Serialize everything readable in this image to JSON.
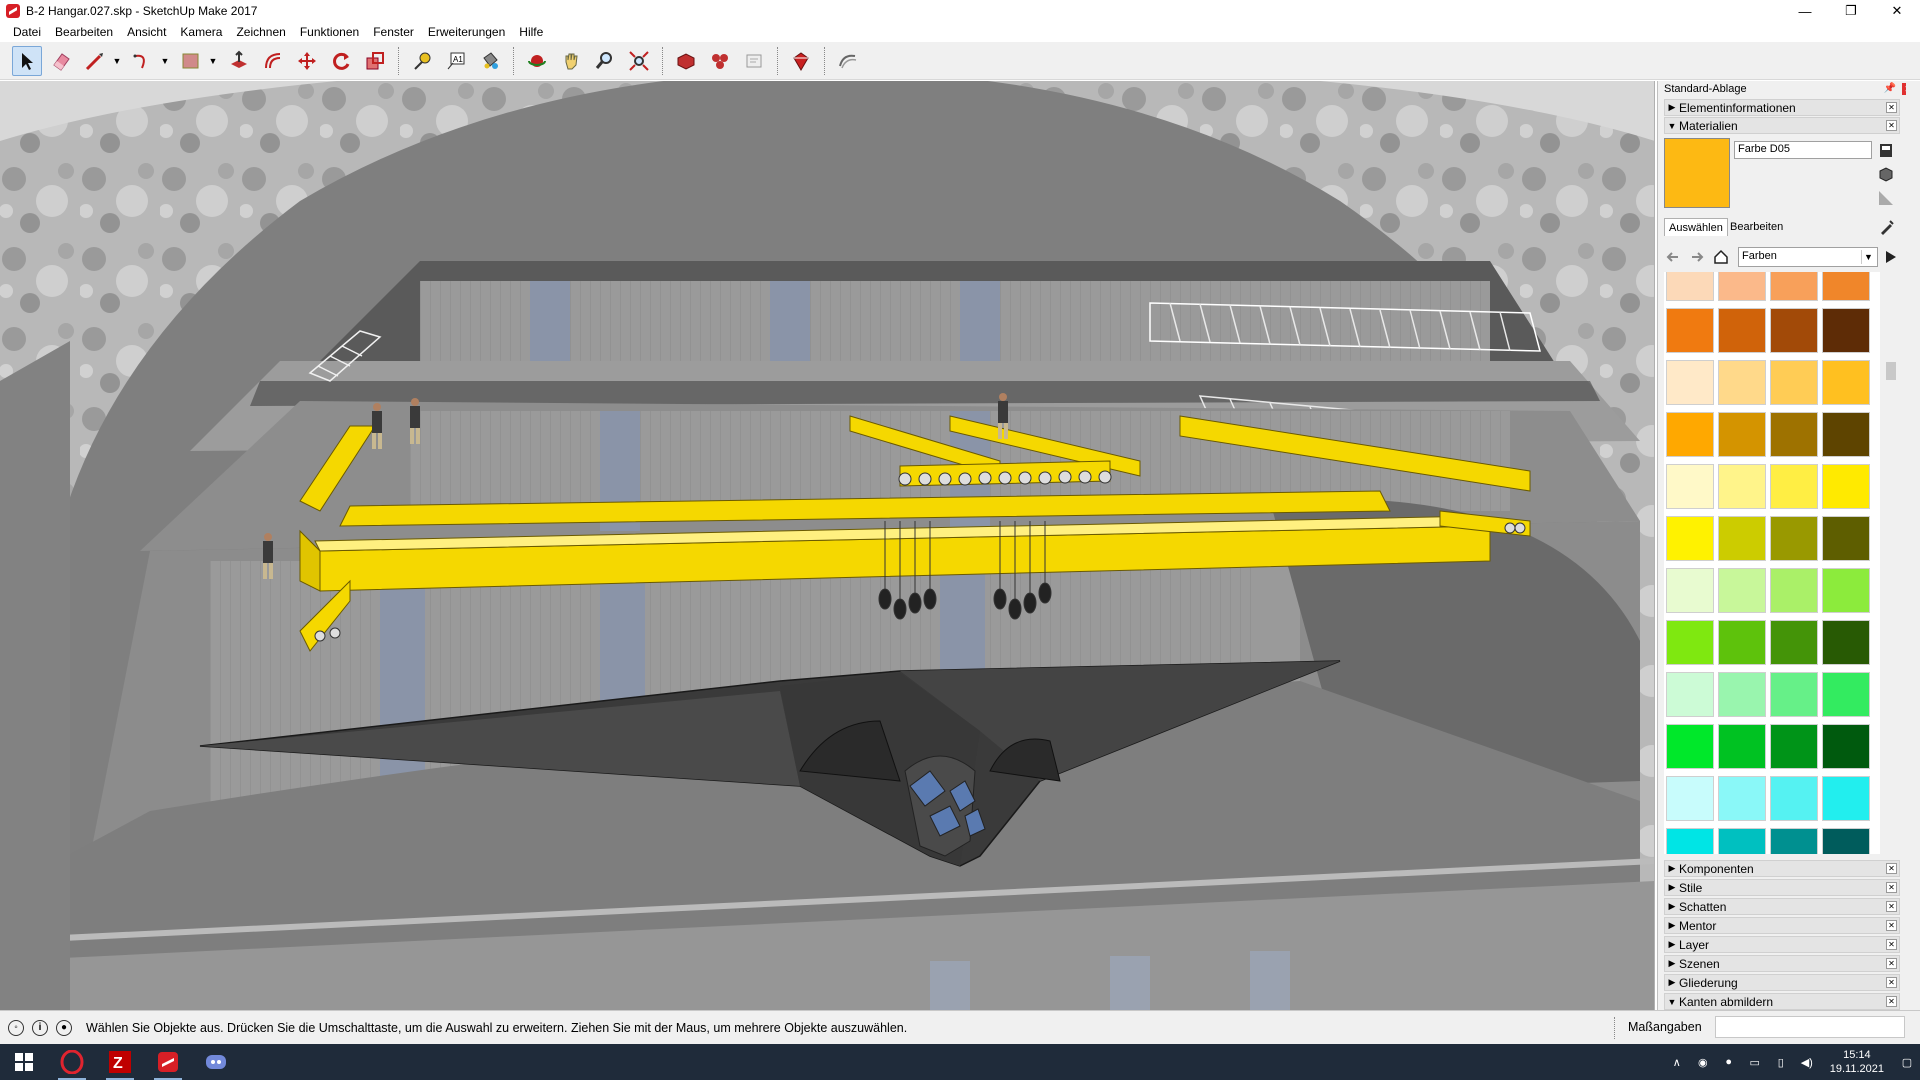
{
  "window": {
    "title": "B-2 Hangar.027.skp - SketchUp Make 2017",
    "minimize": "—",
    "maximize": "❐",
    "close": "✕"
  },
  "menu": [
    "Datei",
    "Bearbeiten",
    "Ansicht",
    "Kamera",
    "Zeichnen",
    "Funktionen",
    "Fenster",
    "Erweiterungen",
    "Hilfe"
  ],
  "toolbar": {
    "tools": [
      "select-tool",
      "eraser-tool",
      "line-tool",
      "arc-tool",
      "shape-tool",
      "push-pull-tool",
      "offset-tool",
      "move-tool",
      "rotate-tool",
      "scale-tool",
      "tape-measure-tool",
      "text-tool",
      "paint-bucket-tool",
      "orbit-tool",
      "pan-tool",
      "zoom-tool",
      "zoom-extents-tool",
      "3d-warehouse-tool",
      "extension-warehouse-tool",
      "layout-tool",
      "extension-manager-tool",
      "sandbox-tool"
    ]
  },
  "tray": {
    "title": "Standard-Ablage",
    "panels_top": [
      {
        "label": "Elementinformationen",
        "expanded": false
      },
      {
        "label": "Materialien",
        "expanded": true
      }
    ],
    "material": {
      "name": "Farbe D05",
      "color": "#FDB913",
      "tabs": [
        "Auswählen",
        "Bearbeiten"
      ],
      "active_tab": "Auswählen",
      "library": "Farben"
    },
    "swatch_rows": [
      [
        "#FCD9B8",
        "#FBB98A",
        "#F8A05A",
        "#F0862A"
      ],
      [
        "#F07A10",
        "#D0630A",
        "#A24A08",
        "#5E2C06"
      ],
      [
        "#FFE9C8",
        "#FFD98A",
        "#FFCC55",
        "#FFC020"
      ],
      [
        "#FFA800",
        "#D49400",
        "#9E7200",
        "#5E4400"
      ],
      [
        "#FFF9C8",
        "#FFF48A",
        "#FFEE44",
        "#FFEA00"
      ],
      [
        "#FFF200",
        "#CCCC00",
        "#999900",
        "#5E5E00"
      ],
      [
        "#E8FBD0",
        "#C8F79A",
        "#AAF068",
        "#8CEB3C"
      ],
      [
        "#7FE810",
        "#5EC20C",
        "#449408",
        "#285A04"
      ],
      [
        "#CCFBD6",
        "#99F5AE",
        "#66F088",
        "#33EB60"
      ],
      [
        "#00E82A",
        "#00C222",
        "#009418",
        "#005A0E"
      ],
      [
        "#C8FCFC",
        "#8AF8F8",
        "#55F2F2",
        "#22EEEE"
      ],
      [
        "#00E5E5",
        "#00C0C0",
        "#009090",
        "#005C5C"
      ]
    ],
    "panels_bottom": [
      {
        "label": "Komponenten"
      },
      {
        "label": "Stile"
      },
      {
        "label": "Schatten"
      },
      {
        "label": "Mentor"
      },
      {
        "label": "Layer"
      },
      {
        "label": "Szenen"
      },
      {
        "label": "Gliederung"
      },
      {
        "label": "Kanten abmildern",
        "expanded": true
      }
    ]
  },
  "status": {
    "message": "Wählen Sie Objekte aus. Drücken Sie die Umschalttaste, um die Auswahl zu erweitern. Ziehen Sie mit der Maus, um mehrere Objekte auszuwählen.",
    "measurements_label": "Maßangaben",
    "measurements_value": ""
  },
  "taskbar": {
    "apps": [
      "windows-start",
      "opera",
      "filezilla",
      "sketchup",
      "discord"
    ],
    "time": "15:14",
    "date": "19.11.2021"
  },
  "colors": {
    "crane_yellow": "#F5D800",
    "accent": "#0078D7"
  }
}
